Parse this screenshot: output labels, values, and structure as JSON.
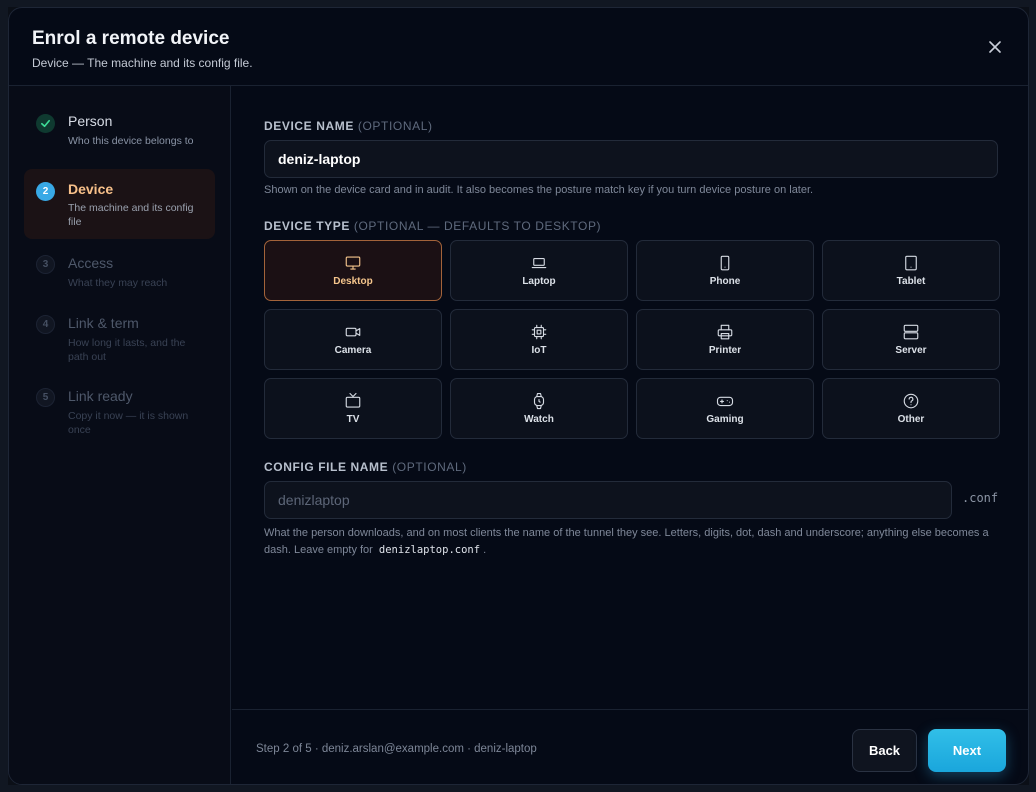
{
  "dialog": {
    "title": "Enrol a remote device",
    "subtitle": "Device — The machine and its config file."
  },
  "steps": [
    {
      "number": "1",
      "title": "Person",
      "desc": "Who this device belongs to",
      "state": "done"
    },
    {
      "number": "2",
      "title": "Device",
      "desc": "The machine and its config file",
      "state": "active"
    },
    {
      "number": "3",
      "title": "Access",
      "desc": "What they may reach",
      "state": "pending"
    },
    {
      "number": "4",
      "title": "Link & term",
      "desc": "How long it lasts, and the path out",
      "state": "pending"
    },
    {
      "number": "5",
      "title": "Link ready",
      "desc": "Copy it now — it is shown once",
      "state": "pending"
    }
  ],
  "device_name": {
    "label": "DEVICE NAME",
    "optional": "(OPTIONAL)",
    "value": "deniz-laptop",
    "hint": "Shown on the device card and in audit. It also becomes the posture match key if you turn device posture on later."
  },
  "device_type": {
    "label": "DEVICE TYPE",
    "optional": "(OPTIONAL — DEFAULTS TO DESKTOP)",
    "selected": "Desktop",
    "options": [
      {
        "label": "Desktop",
        "icon": "monitor-icon"
      },
      {
        "label": "Laptop",
        "icon": "laptop-icon"
      },
      {
        "label": "Phone",
        "icon": "phone-icon"
      },
      {
        "label": "Tablet",
        "icon": "tablet-icon"
      },
      {
        "label": "Camera",
        "icon": "camera-icon"
      },
      {
        "label": "IoT",
        "icon": "chip-icon"
      },
      {
        "label": "Printer",
        "icon": "printer-icon"
      },
      {
        "label": "Server",
        "icon": "server-icon"
      },
      {
        "label": "TV",
        "icon": "tv-icon"
      },
      {
        "label": "Watch",
        "icon": "watch-icon"
      },
      {
        "label": "Gaming",
        "icon": "gamepad-icon"
      },
      {
        "label": "Other",
        "icon": "help-circle-icon"
      }
    ]
  },
  "config_file": {
    "label": "CONFIG FILE NAME",
    "optional": "(OPTIONAL)",
    "placeholder": "denizlaptop",
    "suffix": ".conf",
    "hint_part1": "What the person downloads, and on most clients the name of the tunnel they see. Letters, digits, dot, dash and underscore; anything else becomes a dash. Leave empty for",
    "hint_code": "denizlaptop.conf",
    "hint_end": "."
  },
  "footer": {
    "status": "Step 2 of 5 · deniz.arslan@example.com · deniz-laptop",
    "back_label": "Back",
    "next_label": "Next"
  },
  "colors": {
    "accent": "#1aa6dc",
    "selected_border": "#a3633a",
    "active_step_text": "#f7c08a",
    "done_check": "#3ddc97"
  }
}
